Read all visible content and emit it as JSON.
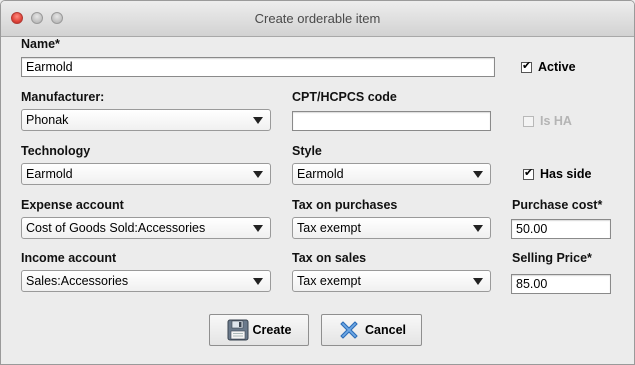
{
  "window": {
    "title": "Create orderable item"
  },
  "name": {
    "label": "Name*",
    "value": "Earmold"
  },
  "active": {
    "label": "Active",
    "checked": true
  },
  "manufacturer": {
    "label": "Manufacturer:",
    "value": "Phonak"
  },
  "cpt": {
    "label": "CPT/HCPCS code",
    "value": ""
  },
  "is_ha": {
    "label": "Is HA",
    "checked": false,
    "enabled": false
  },
  "technology": {
    "label": "Technology",
    "value": "Earmold"
  },
  "style": {
    "label": "Style",
    "value": "Earmold"
  },
  "has_side": {
    "label": "Has side",
    "checked": true
  },
  "expense_account": {
    "label": "Expense account",
    "value": "Cost of Goods Sold:Accessories"
  },
  "tax_purchases": {
    "label": "Tax on purchases",
    "value": "Tax exempt"
  },
  "purchase_cost": {
    "label": "Purchase cost*",
    "value": "50.00"
  },
  "income_account": {
    "label": "Income account",
    "value": "Sales:Accessories"
  },
  "tax_sales": {
    "label": "Tax on sales",
    "value": "Tax exempt"
  },
  "selling_price": {
    "label": "Selling Price*",
    "value": "85.00"
  },
  "buttons": {
    "create": "Create",
    "cancel": "Cancel"
  },
  "check_glyph": "✔",
  "icons": {
    "create": "floppy-disk-icon",
    "cancel": "x-cross-icon"
  },
  "colors": {
    "close_light": "#e0443a",
    "cancel_icon": "#4a8fd8",
    "disabled_text": "#b4b4b4"
  }
}
